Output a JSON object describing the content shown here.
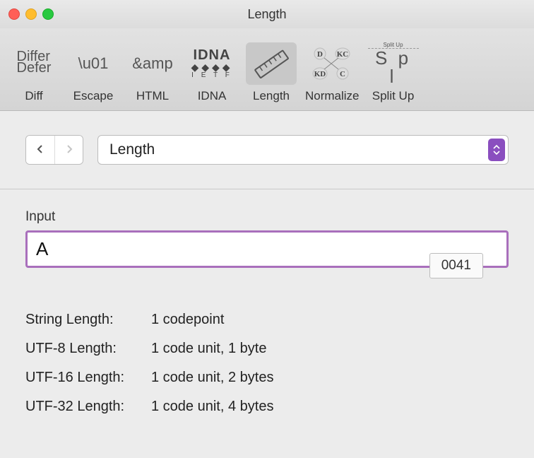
{
  "window": {
    "title": "Length"
  },
  "toolbar": {
    "items": [
      {
        "label": "Diff"
      },
      {
        "label": "Escape"
      },
      {
        "label": "HTML"
      },
      {
        "label": "IDNA"
      },
      {
        "label": "Length",
        "selected": true
      },
      {
        "label": "Normalize"
      },
      {
        "label": "Split Up"
      }
    ],
    "diff_icon_lines": [
      "Differ",
      "Defer"
    ],
    "escape_icon": "\\u01",
    "html_icon": "&amp",
    "idna_icon": {
      "top": "IDNA",
      "mid": "◆◆◆◆",
      "bot": "I E T F"
    },
    "normalize_icon": {
      "tl": "D",
      "tr": "KC",
      "bl": "KD",
      "br": "C"
    },
    "splitup_icon": {
      "top": "Split Up",
      "main": "S p l"
    }
  },
  "dropdown": {
    "selected": "Length"
  },
  "input": {
    "label": "Input",
    "value": "A",
    "badge": "0041"
  },
  "results": [
    {
      "key": "String Length:",
      "value": "1 codepoint"
    },
    {
      "key": "UTF-8 Length:",
      "value": "1 code unit, 1 byte"
    },
    {
      "key": "UTF-16 Length:",
      "value": "1 code unit, 2 bytes"
    },
    {
      "key": "UTF-32 Length:",
      "value": "1 code unit, 4 bytes"
    }
  ]
}
